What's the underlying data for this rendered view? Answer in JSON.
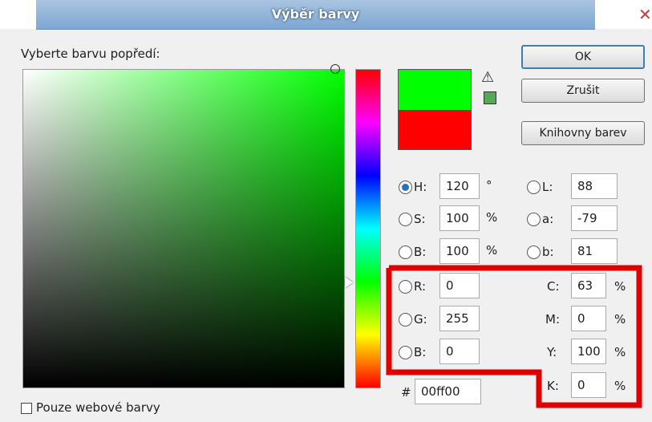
{
  "dialog": {
    "title": "Výběr barvy",
    "prompt": "Vyberte barvu popředí:"
  },
  "colors": {
    "new_color": "#00ff00",
    "current_color": "#ff0000",
    "websafe_color": "#58a858",
    "highlight": "#e00000"
  },
  "icons": {
    "close": "✕",
    "warning": "⚠"
  },
  "buttons": {
    "ok": "OK",
    "cancel": "Zrušit",
    "libraries": "Knihovny barev"
  },
  "hsb": {
    "h": {
      "label": "H:",
      "value": "120",
      "unit": "°"
    },
    "s": {
      "label": "S:",
      "value": "100",
      "unit": "%"
    },
    "b": {
      "label": "B:",
      "value": "100",
      "unit": "%"
    }
  },
  "lab": {
    "l": {
      "label": "L:",
      "value": "88"
    },
    "a": {
      "label": "a:",
      "value": "-79"
    },
    "b": {
      "label": "b:",
      "value": "81"
    }
  },
  "rgb": {
    "r": {
      "label": "R:",
      "value": "0"
    },
    "g": {
      "label": "G:",
      "value": "255"
    },
    "b": {
      "label": "B:",
      "value": "0"
    }
  },
  "cmyk": {
    "c": {
      "label": "C:",
      "value": "63",
      "unit": "%"
    },
    "m": {
      "label": "M:",
      "value": "0",
      "unit": "%"
    },
    "y": {
      "label": "Y:",
      "value": "100",
      "unit": "%"
    },
    "k": {
      "label": "K:",
      "value": "0",
      "unit": "%"
    }
  },
  "hex": {
    "label": "#",
    "value": "00ff00"
  },
  "web_only": {
    "label": "Pouze webové barvy",
    "checked": false
  }
}
